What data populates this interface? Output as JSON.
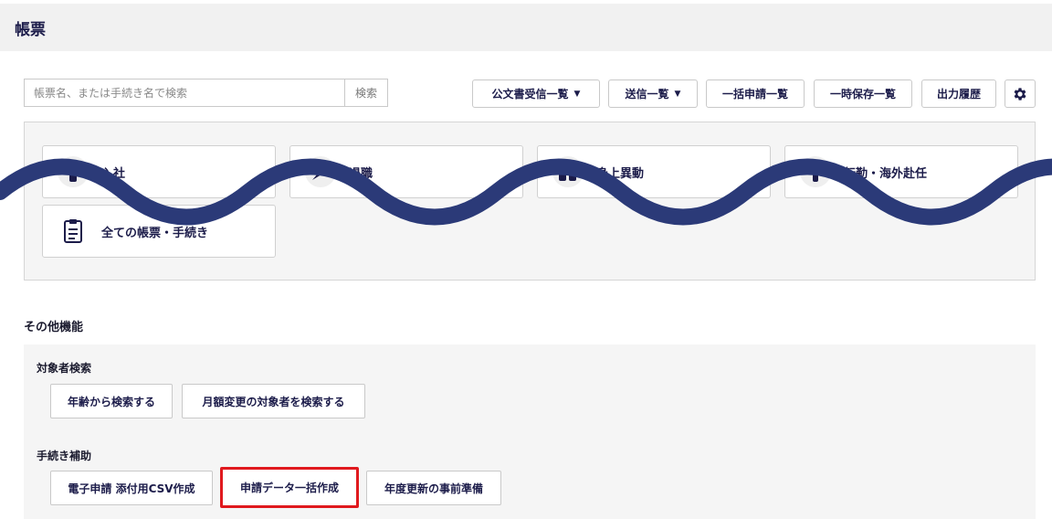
{
  "header": {
    "title": "帳票"
  },
  "search": {
    "placeholder": "帳票名、または手続き名で検索",
    "value": "",
    "button_label": "検索"
  },
  "toolbar": {
    "buttons": [
      {
        "label": "公文書受信一覧",
        "has_dropdown": true
      },
      {
        "label": "送信一覧",
        "has_dropdown": true
      },
      {
        "label": "一括申請一覧",
        "has_dropdown": false
      },
      {
        "label": "一時保存一覧",
        "has_dropdown": false
      },
      {
        "label": "出力履歴",
        "has_dropdown": false
      }
    ],
    "dropdown_caret": "▼",
    "settings_icon": "gear-icon"
  },
  "form_tiles": [
    {
      "label": "入社",
      "icon": "person-icon"
    },
    {
      "label": "退職",
      "icon": "bouquet-icon"
    },
    {
      "label": "身上異動",
      "icon": "family-icon"
    },
    {
      "label": "転勤・海外赴任",
      "icon": "traveler-icon"
    },
    {
      "label": "全ての帳票・手続き",
      "icon": "document-icon"
    }
  ],
  "other_functions": {
    "title": "その他機能",
    "groups": [
      {
        "label": "対象者検索",
        "buttons": [
          {
            "label": "年齢から検索する"
          },
          {
            "label": "月額変更の対象者を検索する"
          }
        ]
      },
      {
        "label": "手続き補助",
        "buttons": [
          {
            "label": "電子申請 添付用CSV作成"
          },
          {
            "label": "申請データ一括作成",
            "highlighted": true
          },
          {
            "label": "年度更新の事前準備"
          }
        ]
      }
    ]
  },
  "colors": {
    "navy_text": "#1c1c4a",
    "wave": "#2b3a78",
    "highlight_border": "#e0191e",
    "panel_bg": "#f5f5f5",
    "header_bg": "#f1f1f1"
  }
}
